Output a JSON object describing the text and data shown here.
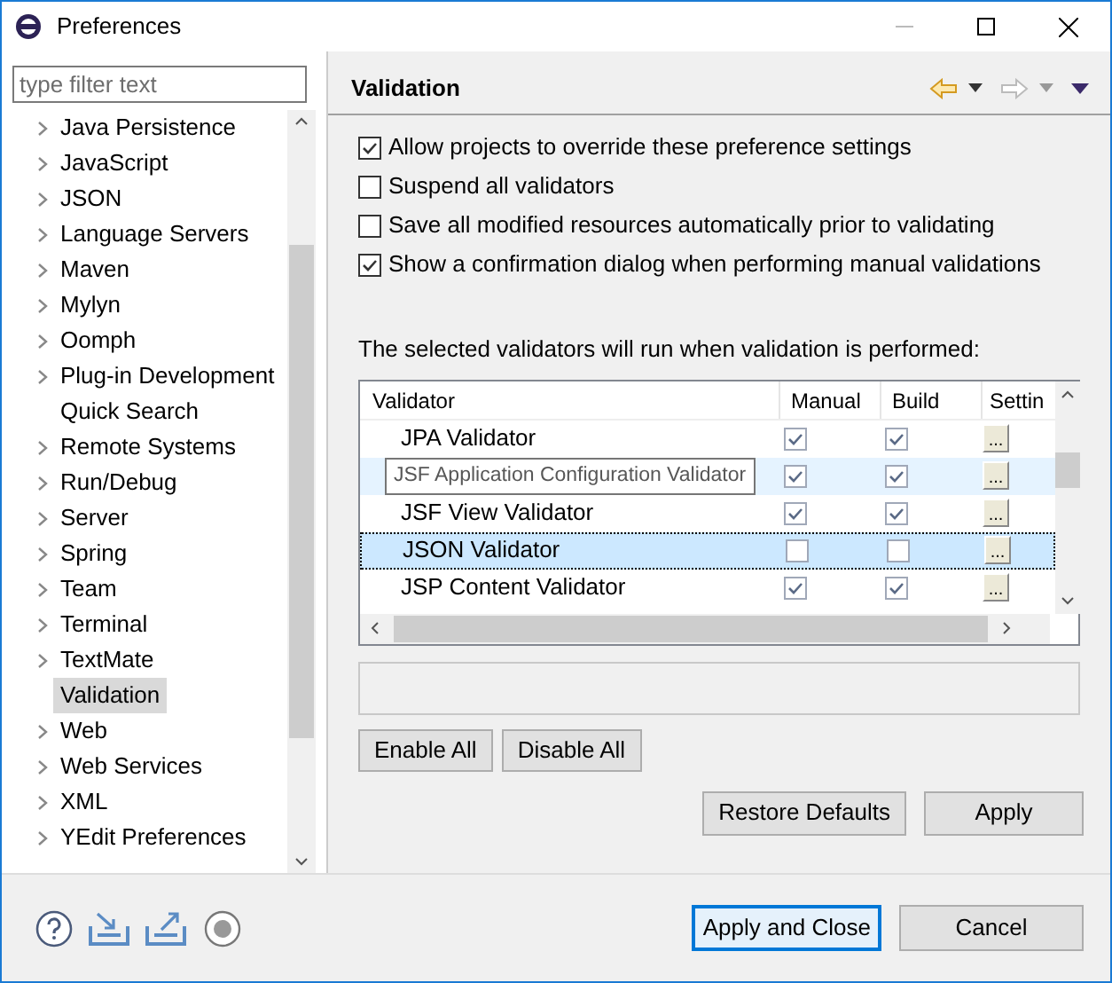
{
  "window": {
    "title": "Preferences"
  },
  "filter": {
    "placeholder": "type filter text"
  },
  "tree": [
    {
      "label": "Java Persistence",
      "expandable": true,
      "selected": false
    },
    {
      "label": "JavaScript",
      "expandable": true,
      "selected": false
    },
    {
      "label": "JSON",
      "expandable": true,
      "selected": false
    },
    {
      "label": "Language Servers",
      "expandable": true,
      "selected": false
    },
    {
      "label": "Maven",
      "expandable": true,
      "selected": false
    },
    {
      "label": "Mylyn",
      "expandable": true,
      "selected": false
    },
    {
      "label": "Oomph",
      "expandable": true,
      "selected": false
    },
    {
      "label": "Plug-in Development",
      "expandable": true,
      "selected": false
    },
    {
      "label": "Quick Search",
      "expandable": false,
      "selected": false
    },
    {
      "label": "Remote Systems",
      "expandable": true,
      "selected": false
    },
    {
      "label": "Run/Debug",
      "expandable": true,
      "selected": false
    },
    {
      "label": "Server",
      "expandable": true,
      "selected": false
    },
    {
      "label": "Spring",
      "expandable": true,
      "selected": false
    },
    {
      "label": "Team",
      "expandable": true,
      "selected": false
    },
    {
      "label": "Terminal",
      "expandable": true,
      "selected": false
    },
    {
      "label": "TextMate",
      "expandable": true,
      "selected": false
    },
    {
      "label": "Validation",
      "expandable": false,
      "selected": true
    },
    {
      "label": "Web",
      "expandable": true,
      "selected": false
    },
    {
      "label": "Web Services",
      "expandable": true,
      "selected": false
    },
    {
      "label": "XML",
      "expandable": true,
      "selected": false
    },
    {
      "label": "YEdit Preferences",
      "expandable": true,
      "selected": false
    }
  ],
  "page": {
    "title": "Validation",
    "options": [
      {
        "label": "Allow projects to override these preference settings",
        "checked": true
      },
      {
        "label": "Suspend all validators",
        "checked": false
      },
      {
        "label": "Save all modified resources automatically prior to validating",
        "checked": false
      },
      {
        "label": "Show a confirmation dialog when performing manual validations",
        "checked": true
      }
    ],
    "table_caption": "The selected validators will run when validation is performed:",
    "table": {
      "columns": [
        "Validator",
        "Manual",
        "Build",
        "Settin"
      ],
      "rows": [
        {
          "name": "JPA Validator",
          "manual": true,
          "build": true,
          "settings": "...",
          "selected": false
        },
        {
          "manual": true,
          "build": true,
          "settings": "...",
          "selected": false
        },
        {
          "name": "JSF View Validator",
          "manual": true,
          "build": true,
          "settings": "...",
          "selected": false
        },
        {
          "name": "JSON Validator",
          "manual": false,
          "build": false,
          "settings": "...",
          "selected": true
        },
        {
          "name": "JSP Content Validator",
          "manual": true,
          "build": true,
          "settings": "...",
          "selected": false
        }
      ],
      "tooltip": "JSF Application Configuration Validator"
    },
    "table_buttons": [
      "Enable All",
      "Disable All"
    ],
    "buttons": [
      "Restore Defaults",
      "Apply"
    ]
  },
  "footer_buttons": [
    {
      "label": "Apply and Close",
      "default": true
    },
    {
      "label": "Cancel",
      "default": false
    }
  ]
}
